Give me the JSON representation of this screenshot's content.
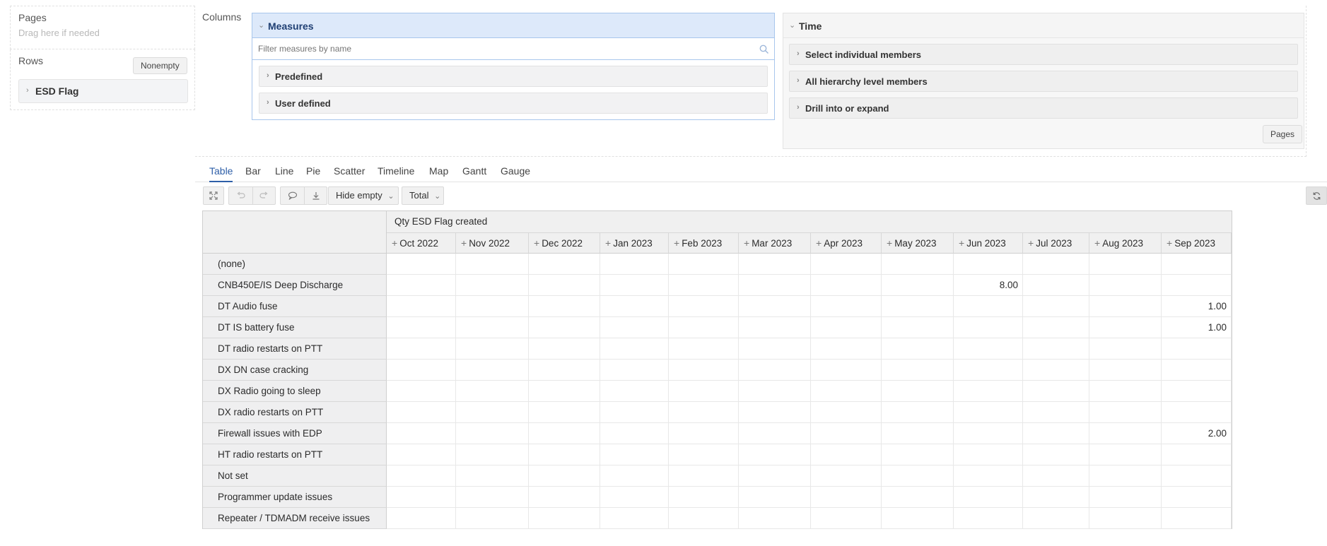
{
  "pages": {
    "title": "Pages",
    "hint": "Drag here if needed"
  },
  "rows": {
    "title": "Rows",
    "nonempty_label": "Nonempty",
    "field": "ESD Flag"
  },
  "columns": {
    "title": "Columns"
  },
  "measures": {
    "title": "Measures",
    "filter_placeholder": "Filter measures by name",
    "groups": [
      "Predefined",
      "User defined"
    ]
  },
  "time": {
    "title": "Time",
    "items": [
      "Select individual members",
      "All hierarchy level members",
      "Drill into or expand"
    ],
    "pages_button": "Pages"
  },
  "tabs": [
    "Table",
    "Bar",
    "Line",
    "Pie",
    "Scatter",
    "Timeline",
    "Map",
    "Gantt",
    "Gauge"
  ],
  "active_tab": "Table",
  "toolbar": {
    "hide_empty": "Hide empty",
    "total": "Total"
  },
  "table": {
    "measure_header": "Qty ESD Flag created",
    "months": [
      "Oct 2022",
      "Nov 2022",
      "Dec 2022",
      "Jan 2023",
      "Feb 2023",
      "Mar 2023",
      "Apr 2023",
      "May 2023",
      "Jun 2023",
      "Jul 2023",
      "Aug 2023",
      "Sep 2023"
    ],
    "rows": [
      {
        "label": "(none)",
        "values": [
          "",
          "",
          "",
          "",
          "",
          "",
          "",
          "",
          "",
          "",
          "",
          ""
        ]
      },
      {
        "label": "CNB450E/IS Deep Discharge",
        "values": [
          "",
          "",
          "",
          "",
          "",
          "",
          "",
          "",
          "8.00",
          "",
          "",
          ""
        ]
      },
      {
        "label": "DT Audio fuse",
        "values": [
          "",
          "",
          "",
          "",
          "",
          "",
          "",
          "",
          "",
          "",
          "",
          "1.00"
        ]
      },
      {
        "label": "DT IS battery fuse",
        "values": [
          "",
          "",
          "",
          "",
          "",
          "",
          "",
          "",
          "",
          "",
          "",
          "1.00"
        ]
      },
      {
        "label": "DT radio restarts on PTT",
        "values": [
          "",
          "",
          "",
          "",
          "",
          "",
          "",
          "",
          "",
          "",
          "",
          ""
        ]
      },
      {
        "label": "DX DN case cracking",
        "values": [
          "",
          "",
          "",
          "",
          "",
          "",
          "",
          "",
          "",
          "",
          "",
          ""
        ]
      },
      {
        "label": "DX Radio going to sleep",
        "values": [
          "",
          "",
          "",
          "",
          "",
          "",
          "",
          "",
          "",
          "",
          "",
          ""
        ]
      },
      {
        "label": "DX radio restarts on PTT",
        "values": [
          "",
          "",
          "",
          "",
          "",
          "",
          "",
          "",
          "",
          "",
          "",
          ""
        ]
      },
      {
        "label": "Firewall issues with EDP",
        "values": [
          "",
          "",
          "",
          "",
          "",
          "",
          "",
          "",
          "",
          "",
          "",
          "2.00"
        ]
      },
      {
        "label": "HT radio restarts on PTT",
        "values": [
          "",
          "",
          "",
          "",
          "",
          "",
          "",
          "",
          "",
          "",
          "",
          ""
        ]
      },
      {
        "label": "Not set",
        "values": [
          "",
          "",
          "",
          "",
          "",
          "",
          "",
          "",
          "",
          "",
          "",
          ""
        ]
      },
      {
        "label": "Programmer update issues",
        "values": [
          "",
          "",
          "",
          "",
          "",
          "",
          "",
          "",
          "",
          "",
          "",
          ""
        ]
      },
      {
        "label": "Repeater / TDMADM receive issues",
        "values": [
          "",
          "",
          "",
          "",
          "",
          "",
          "",
          "",
          "",
          "",
          "",
          ""
        ]
      }
    ]
  },
  "icons": {
    "search": "search-icon",
    "fullscreen": "fullscreen-icon",
    "undo": "undo-icon",
    "redo": "redo-icon",
    "comment": "comment-icon",
    "download": "download-icon",
    "refresh": "refresh-icon"
  }
}
